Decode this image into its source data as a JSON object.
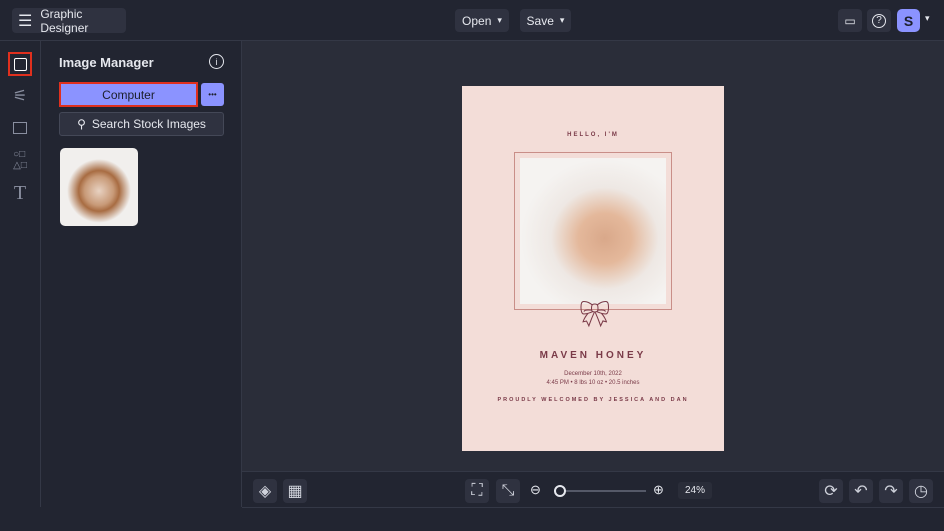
{
  "app": {
    "title": "Graphic Designer",
    "open_label": "Open",
    "save_label": "Save",
    "avatar_initial": "S"
  },
  "panel": {
    "title": "Image Manager",
    "computer_label": "Computer",
    "more_label": "•••",
    "search_label": "Search Stock Images"
  },
  "card": {
    "greeting": "HELLO, I'M",
    "name": "MAVEN HONEY",
    "date": "December 10th, 2022",
    "details": "4:45 PM • 8 lbs 10 oz • 20.5 inches",
    "welcome": "PROUDLY WELCOMED BY JESSICA AND DAN"
  },
  "zoom": {
    "label": "24%",
    "value_percent": 24
  },
  "colors": {
    "accent": "#8b93ff",
    "highlight": "#e0301e"
  }
}
